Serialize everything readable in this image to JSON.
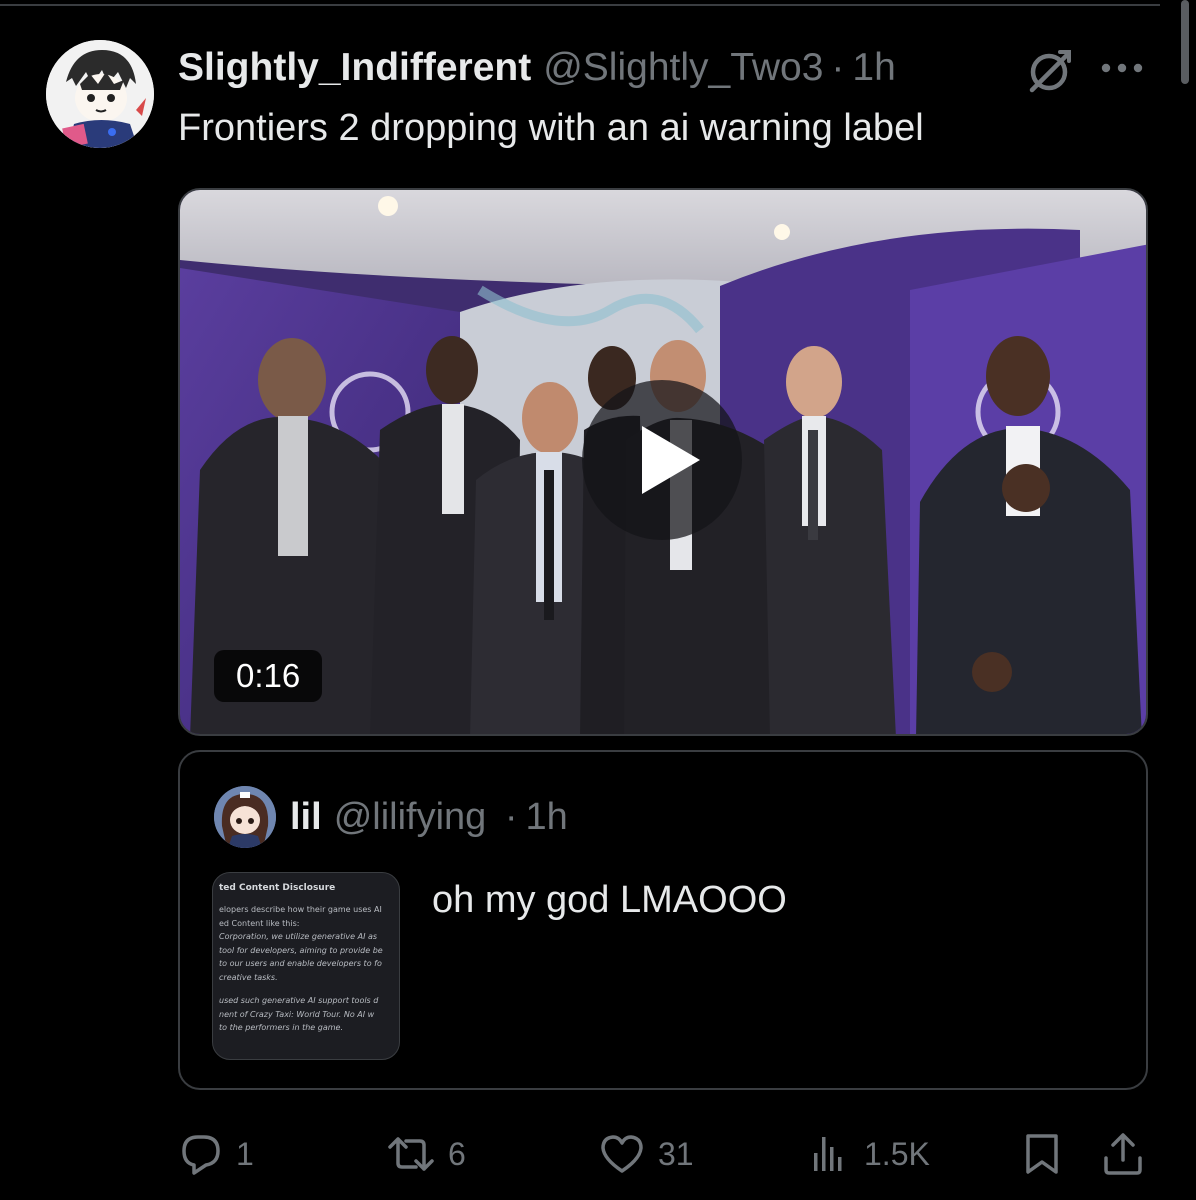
{
  "post": {
    "display_name": "Slightly_Indifferent",
    "handle": "@Slightly_Two3",
    "separator": "·",
    "time": "1h",
    "text": "Frontiers 2 dropping with an ai warning label",
    "video_duration": "0:16"
  },
  "quoted_post": {
    "display_name": "lil",
    "handle": "@lilifying",
    "separator": "·",
    "time": "1h",
    "text": "oh my god LMAOOO",
    "thumbnail": {
      "title": "ted Content Disclosure",
      "lines": [
        "elopers describe how their game uses AI",
        "ed Content like this:"
      ],
      "italic_lines_1": [
        "Corporation, we utilize generative AI as",
        "tool for developers, aiming to provide be",
        "to our users and enable developers to fo",
        "creative tasks."
      ],
      "italic_lines_2": [
        "used such generative AI support tools d",
        "nent of Crazy Taxi: World Tour. No AI w",
        "to the performers in the game."
      ]
    }
  },
  "actions": {
    "replies": "1",
    "reposts": "6",
    "likes": "31",
    "views": "1.5K"
  },
  "icons": [
    "grok-icon",
    "more-icon",
    "play-icon",
    "reply-icon",
    "repost-icon",
    "like-icon",
    "views-icon",
    "bookmark-icon",
    "share-icon"
  ]
}
